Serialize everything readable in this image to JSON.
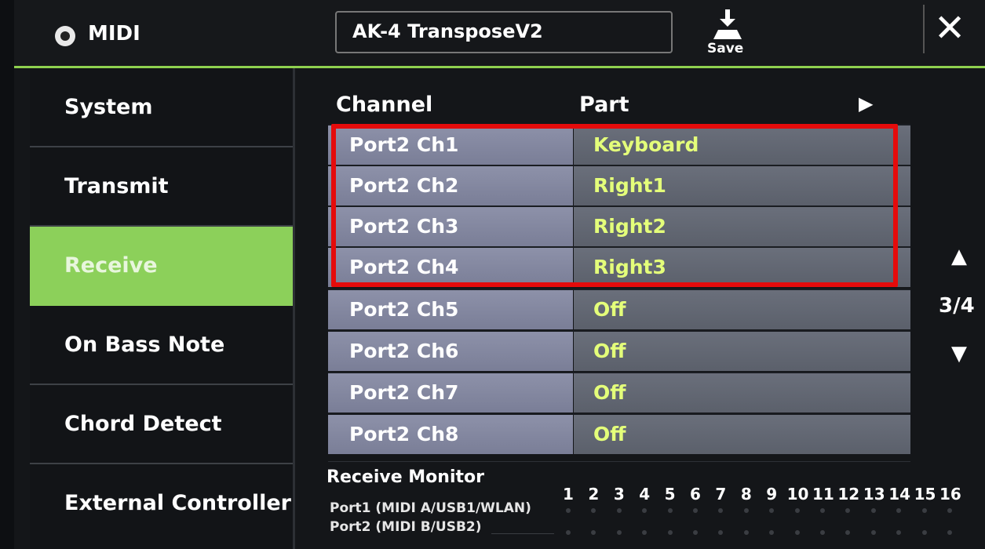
{
  "header": {
    "app_title": "MIDI",
    "song_title": "AK-4 TransposeV2",
    "save_label": "Save",
    "close_label": "✕"
  },
  "sidebar": {
    "items": [
      {
        "label": "System"
      },
      {
        "label": "Transmit"
      },
      {
        "label": "Receive",
        "active": true
      },
      {
        "label": "On Bass Note"
      },
      {
        "label": "Chord Detect"
      },
      {
        "label": "External Controller"
      }
    ]
  },
  "table": {
    "headers": {
      "channel": "Channel",
      "part": "Part"
    },
    "rows": [
      {
        "channel": "Port2 Ch1",
        "part": "Keyboard"
      },
      {
        "channel": "Port2 Ch2",
        "part": "Right1"
      },
      {
        "channel": "Port2 Ch3",
        "part": "Right2"
      },
      {
        "channel": "Port2 Ch4",
        "part": "Right3"
      },
      {
        "channel": "Port2 Ch5",
        "part": "Off"
      },
      {
        "channel": "Port2 Ch6",
        "part": "Off"
      },
      {
        "channel": "Port2 Ch7",
        "part": "Off"
      },
      {
        "channel": "Port2 Ch8",
        "part": "Off"
      }
    ]
  },
  "pager": {
    "page": "3/4"
  },
  "monitor": {
    "title": "Receive Monitor",
    "port1": "Port1 (MIDI A/USB1/WLAN)",
    "port2": "Port2 (MIDI B/USB2)",
    "channels": [
      "1",
      "2",
      "3",
      "4",
      "5",
      "6",
      "7",
      "8",
      "9",
      "10",
      "11",
      "12",
      "13",
      "14",
      "15",
      "16"
    ]
  },
  "colors": {
    "accent": "#8cd05a",
    "highlight": "#e50b0b",
    "part_text": "#e4ff7a"
  }
}
